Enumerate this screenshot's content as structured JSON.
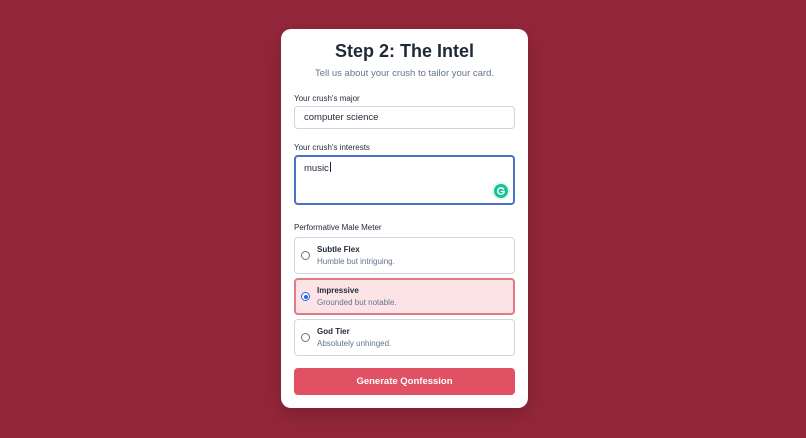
{
  "form": {
    "title": "Step 2: The Intel",
    "subtitle": "Tell us about your crush to tailor your card.",
    "major": {
      "label": "Your crush's major",
      "value": "computer science"
    },
    "interests": {
      "label": "Your crush's interests",
      "value": "music"
    },
    "meter": {
      "label": "Performative Male Meter",
      "options": [
        {
          "title": "Subtle Flex",
          "description": "Humble but intriguing.",
          "selected": false
        },
        {
          "title": "Impressive",
          "description": "Grounded but notable.",
          "selected": true
        },
        {
          "title": "God Tier",
          "description": "Absolutely unhinged.",
          "selected": false
        }
      ]
    },
    "submit_label": "Generate Qonfession"
  },
  "icons": {
    "grammarly": "grammarly-icon"
  },
  "colors": {
    "background": "#93263a",
    "accent": "#e05163",
    "selected_bg": "#fce4e6",
    "focus_border": "#4a72c4"
  }
}
